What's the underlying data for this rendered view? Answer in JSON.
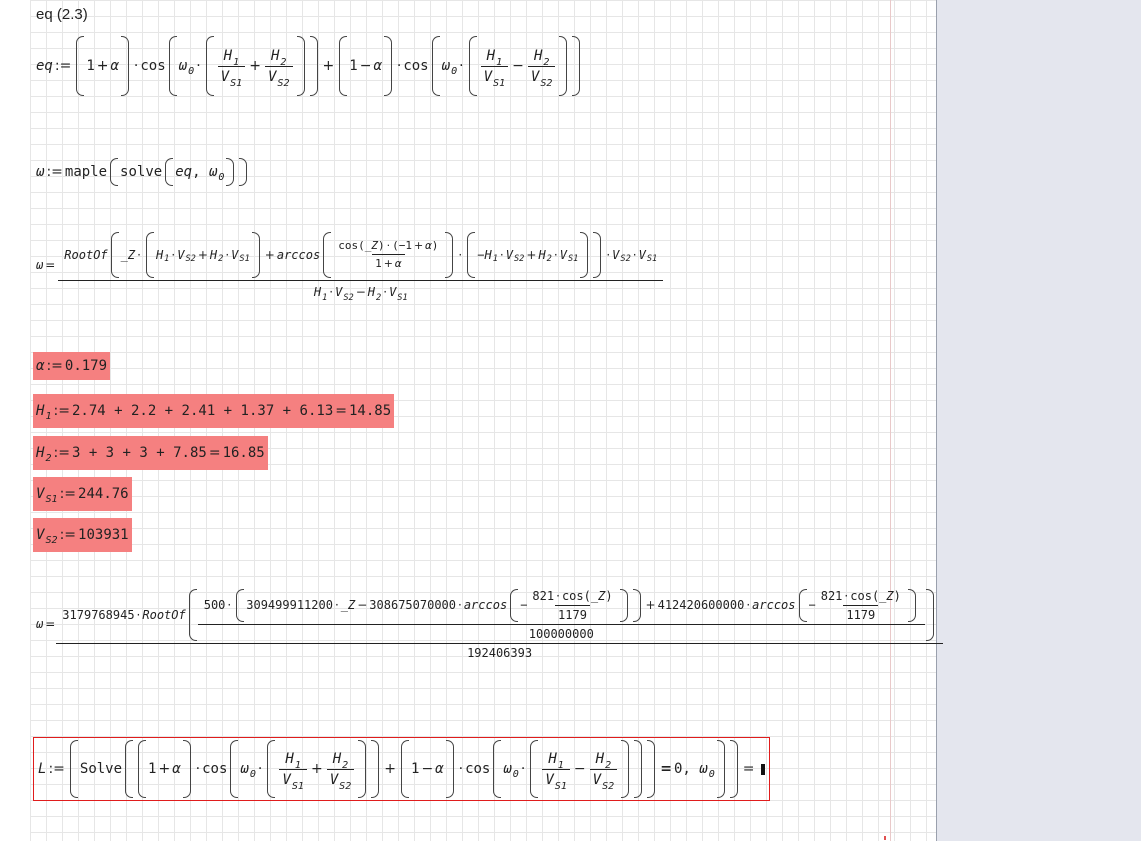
{
  "heading": "eq (2.3)",
  "symbols": {
    "assign": ":=",
    "equals": "=",
    "plus": "+",
    "minus": "−",
    "dot": "·",
    "comma": ",",
    "one": "1",
    "zero": "0",
    "alpha": "α",
    "omega": "ω",
    "cos": "cos",
    "H": "H",
    "V": "V",
    "sub1": "1",
    "sub2": "2",
    "subS1": "S1",
    "subS2": "S2",
    "subO": "0",
    "Z": "_Z",
    "minus_one": "−1",
    "eq": "eq",
    "L": "L"
  },
  "functions": {
    "maple": "maple",
    "solve": "solve",
    "rootof": "RootOf",
    "arccos": "arccos",
    "Solve": "Solve"
  },
  "assignments": {
    "alpha_value": "0.179",
    "h1_expr": "2.74 + 2.2 + 2.41 + 1.37 + 6.13",
    "h1_result": "14.85",
    "h2_expr": "3 + 3 + 3 + 7.85",
    "h2_result": "16.85",
    "vs1_value": "244.76",
    "vs2_value": "103931"
  },
  "numeric_result": {
    "coef": "3179768945",
    "inner_coef": "500",
    "term_a": "309499911200",
    "term_b": "308675070000",
    "term_c": "412420600000",
    "arccos_num": "821",
    "arccos_den": "1179",
    "inner_den": "100000000",
    "outer_den": "192406393"
  },
  "colors": {
    "highlight": "#f58080",
    "region_border": "#e01c1c",
    "grid": "#e6e6e6",
    "side_panel": "#e4e6ee"
  }
}
